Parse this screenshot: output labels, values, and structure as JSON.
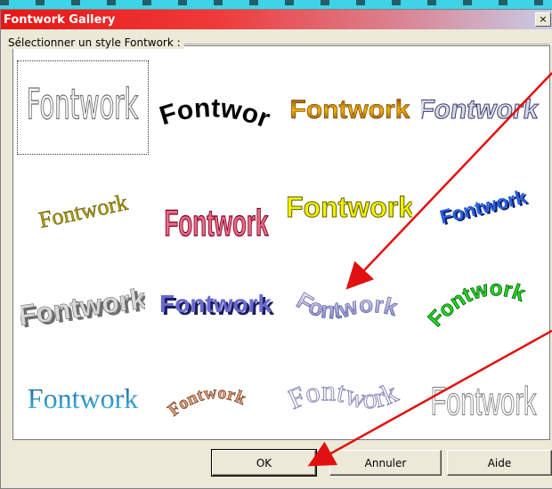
{
  "dialog": {
    "title": "Fontwork Gallery",
    "close_label": "×",
    "group_label": "Sélectionner un style Fontwork :"
  },
  "gallery": {
    "items": [
      {
        "text": "Fontwork",
        "style": "outline-plain",
        "selected": true
      },
      {
        "text": "Fontwork",
        "style": "black-arc"
      },
      {
        "text": "Fontwork",
        "style": "gold-gradient"
      },
      {
        "text": "Fontwork",
        "style": "silver-slant"
      },
      {
        "text": "Fontwork",
        "style": "olive-slanted-serif"
      },
      {
        "text": "Fontwork",
        "style": "pink-perspective"
      },
      {
        "text": "Fontwork",
        "style": "yellow-bold"
      },
      {
        "text": "Fontwork",
        "style": "blue-3d-slant"
      },
      {
        "text": "Fontwork",
        "style": "grey-3d-curve"
      },
      {
        "text": "Fontwork",
        "style": "navy-3d"
      },
      {
        "text": "Fontwork",
        "style": "lavender-wave"
      },
      {
        "text": "Fontwork",
        "style": "green-arch"
      },
      {
        "text": "Fontwork",
        "style": "teal-serif"
      },
      {
        "text": "Fontwork",
        "style": "brown-arch"
      },
      {
        "text": "Fontwork",
        "style": "outline-wave"
      },
      {
        "text": "Fontwork",
        "style": "outline-condensed"
      }
    ]
  },
  "buttons": {
    "ok_label": "OK",
    "cancel_label": "Annuler",
    "help_label": "Aide"
  },
  "colors": {
    "title_start": "#e81515",
    "title_end": "#c8cde8",
    "dialog_bg": "#ece9d8",
    "annotation_arrow": "#e11010",
    "backdrop": "#3fd3e8"
  }
}
